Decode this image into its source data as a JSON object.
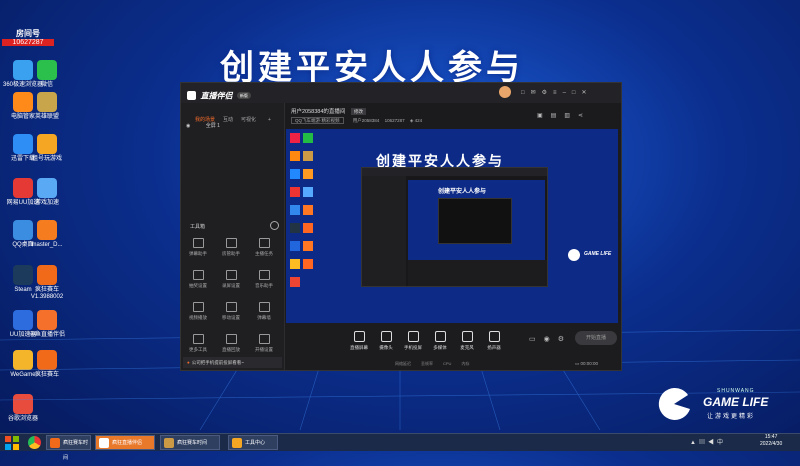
{
  "desktop": {
    "headline": "创建平安人人参与",
    "room_label": "房间号",
    "room_number": "10627287",
    "icons": [
      {
        "label": "360极速浏览器",
        "color": "#3aa0f0"
      },
      {
        "label": "微信",
        "color": "#2bbf4b"
      },
      {
        "label": "电脑管家",
        "color": "#ff8a1a"
      },
      {
        "label": "英雄联盟",
        "color": "#c8a44a"
      },
      {
        "label": "迅雷下载",
        "color": "#2e8ef5"
      },
      {
        "label": "租号玩游戏",
        "color": "#f5a623"
      },
      {
        "label": "网易UU加速",
        "color": "#e53935"
      },
      {
        "label": "游戏加速",
        "color": "#5aa9f5"
      },
      {
        "label": "QQ桌面",
        "color": "#3a8de0"
      },
      {
        "label": "master_D...",
        "color": "#f57c1f"
      },
      {
        "label": "Steam",
        "color": "#1b3a5c"
      },
      {
        "label": "疯狂赛车 V1.3988002",
        "color": "#f06a1a"
      },
      {
        "label": "UU加速器",
        "color": "#2c6cdf"
      },
      {
        "label": "斗鱼直播伴侣",
        "color": "#f5702a"
      },
      {
        "label": "WeGame",
        "color": "#f5b52a"
      },
      {
        "label": "疯狂赛车",
        "color": "#f06a1a"
      },
      {
        "label": "谷歌浏览器",
        "color": "#e84c3d"
      }
    ]
  },
  "app": {
    "logo_text": "直播伴侣",
    "badge": "新版",
    "tabs": [
      "我的场景",
      "互动",
      "可视化"
    ],
    "scene_item": "全屏 1",
    "tools_title": "工具箱",
    "tools": [
      "弹幕助手",
      "房管助手",
      "主播任务",
      "抽奖设置",
      "录屏设置",
      "音乐助手",
      "视频播放",
      "移动设置",
      "弹幕墙",
      "更多工具",
      "直播回放",
      "开播设置"
    ],
    "notice": "公司把手机提前投屏看看~",
    "room_title": "用户2058384的直播间",
    "room_tag": "修改",
    "category": "QQ飞车端游·精彩视频",
    "user_id": "用户2058384",
    "room_id": "10627287",
    "viewers": "424",
    "bottom_buttons": [
      "直播屏幕",
      "摄像头",
      "手机投屏",
      "多媒体",
      "麦克风",
      "扬声器"
    ],
    "stats": [
      "网络延迟",
      "丢帧率",
      "CPU",
      "内存"
    ],
    "timer": "00:00:00",
    "start_label": "开始直播"
  },
  "overlay": {
    "brand": "GAME LIFE",
    "brand_sub": "SHUNWANG",
    "brand_caption": "让游戏更精彩"
  },
  "taskbar": {
    "items": [
      "疯狂赛车时间",
      "疯狂直播伴侣",
      "疯狂赛车时间",
      "工具中心"
    ],
    "clock": "15:47",
    "date": "2022/4/30"
  }
}
